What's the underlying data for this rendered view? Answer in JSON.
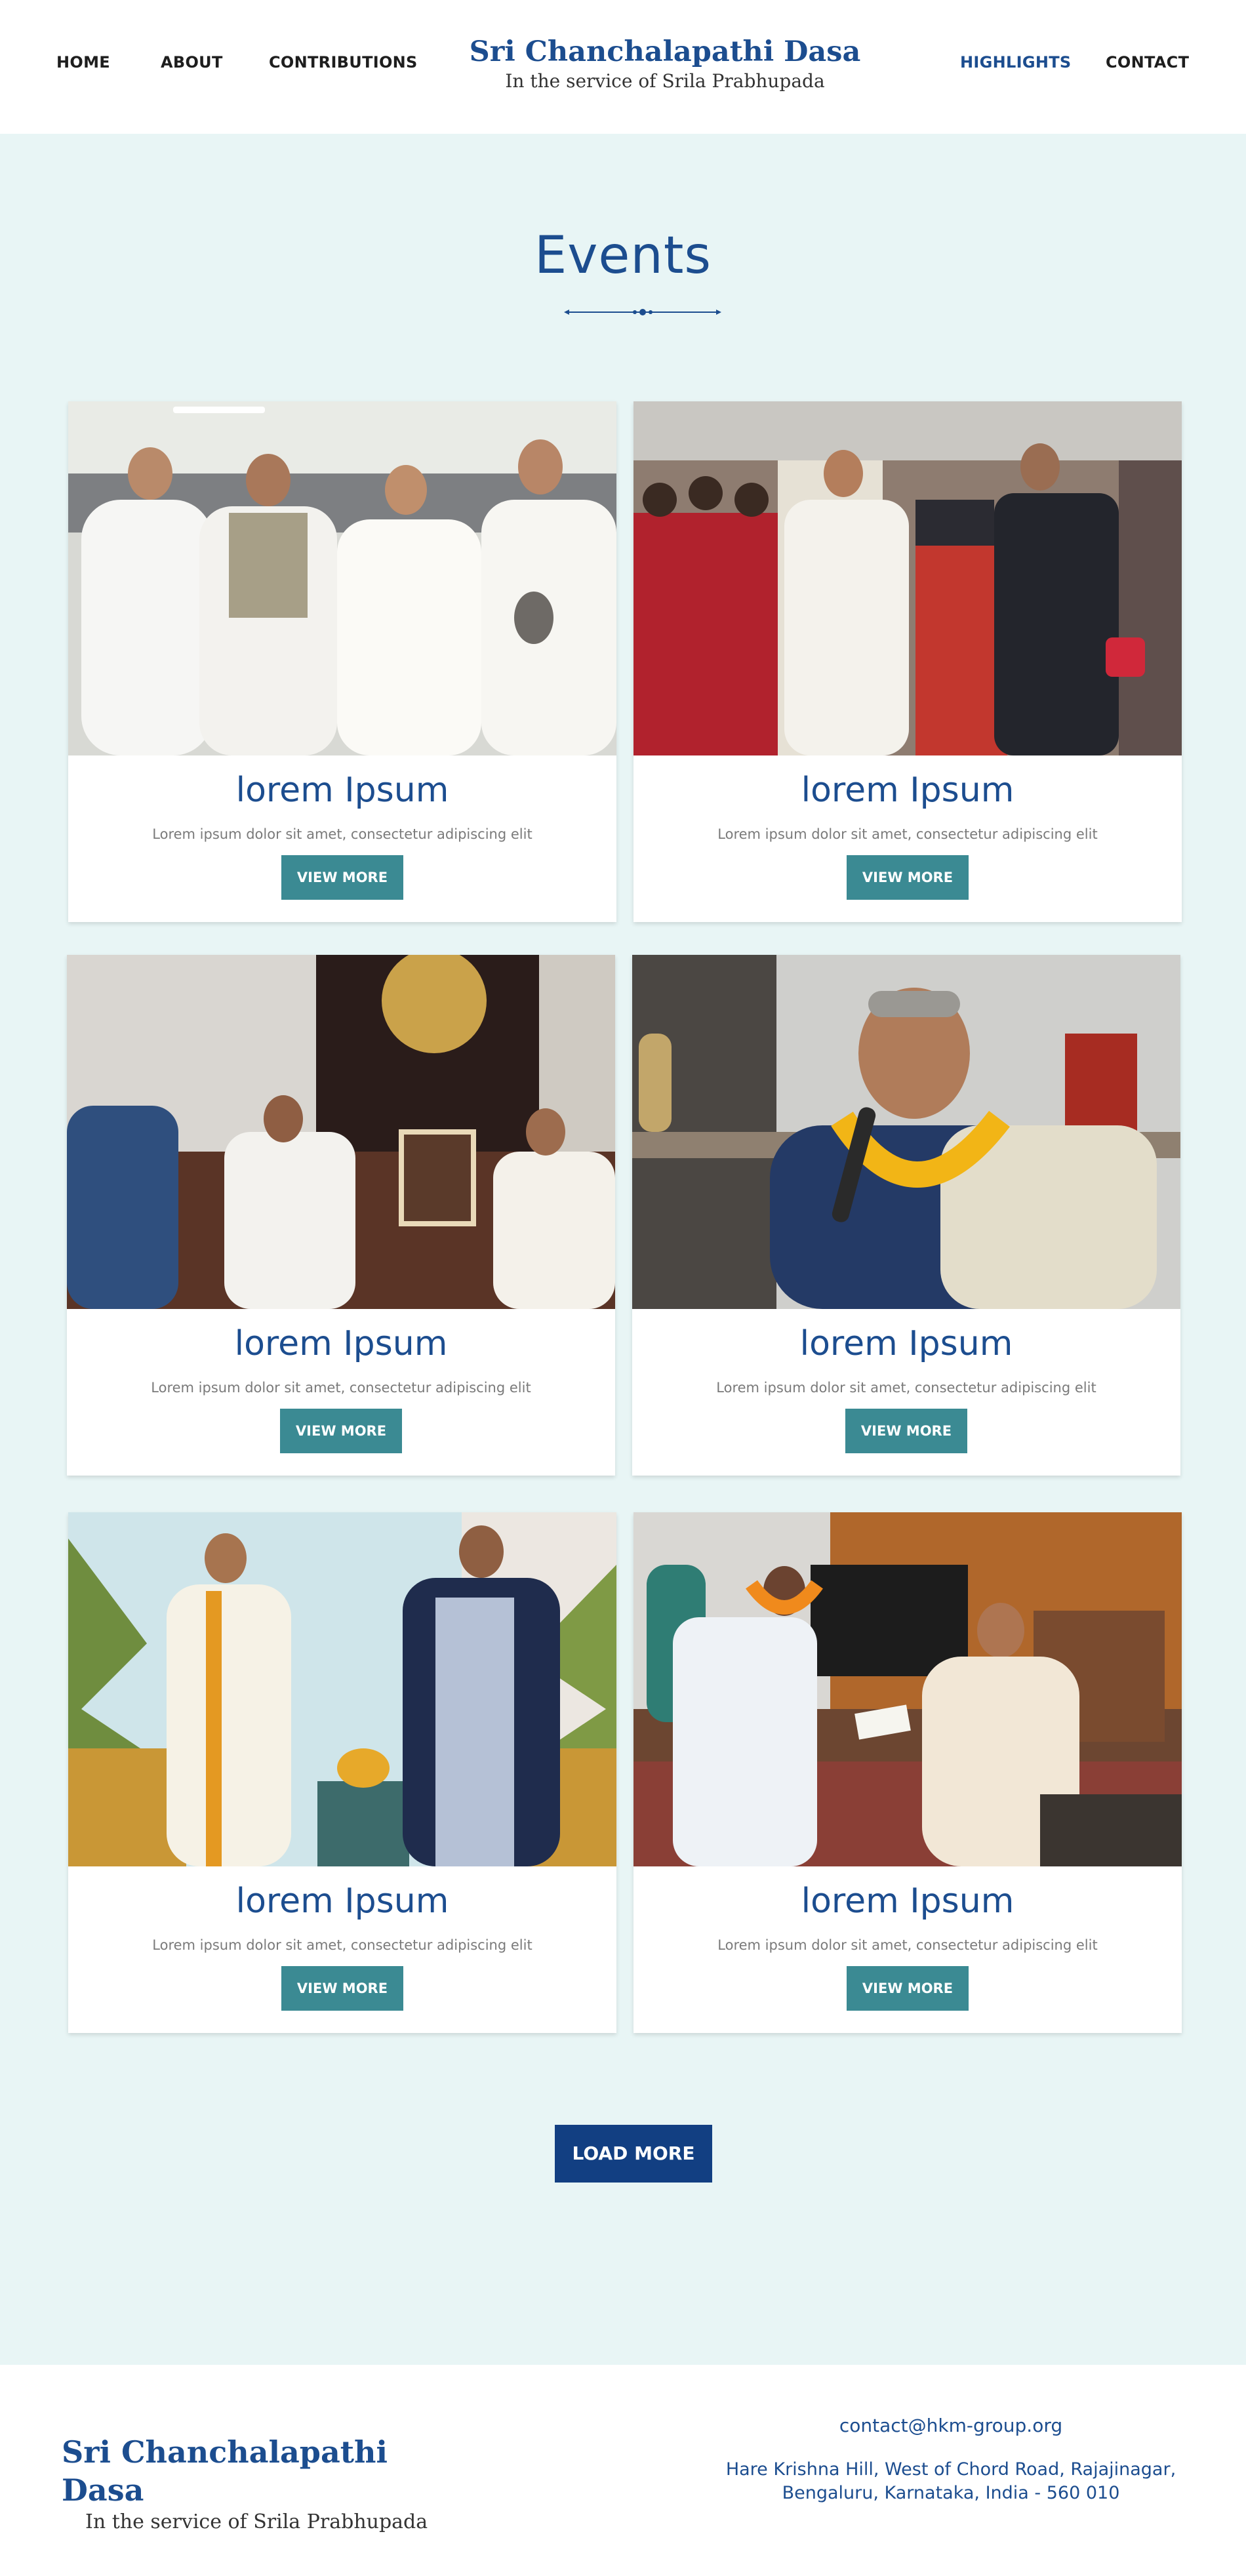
{
  "header": {
    "nav_left": [
      "HOME",
      "ABOUT",
      "CONTRIBUTIONS"
    ],
    "nav_right": [
      "HIGHLIGHTS",
      "CONTACT"
    ],
    "brand_title": "Sri Chanchalapathi Dasa",
    "brand_subtitle": "In the service of Srila Prabhupada"
  },
  "events": {
    "title": "Events",
    "cards": [
      {
        "title": "lorem Ipsum",
        "text": "Lorem ipsum dolor sit amet, consectetur adipiscing elit",
        "button": "VIEW MORE"
      },
      {
        "title": "lorem Ipsum",
        "text": "Lorem ipsum dolor sit amet, consectetur adipiscing elit",
        "button": "VIEW MORE"
      },
      {
        "title": "lorem Ipsum",
        "text": "Lorem ipsum dolor sit amet, consectetur adipiscing elit",
        "button": "VIEW MORE"
      },
      {
        "title": "lorem Ipsum",
        "text": "Lorem ipsum dolor sit amet, consectetur adipiscing elit",
        "button": "VIEW MORE"
      },
      {
        "title": "lorem Ipsum",
        "text": "Lorem ipsum dolor sit amet, consectetur adipiscing elit",
        "button": "VIEW MORE"
      },
      {
        "title": "lorem Ipsum",
        "text": "Lorem ipsum dolor sit amet, consectetur adipiscing elit",
        "button": "VIEW MORE"
      }
    ],
    "load_more": "LOAD MORE"
  },
  "footer": {
    "brand_title": "Sri Chanchalapathi Dasa",
    "brand_subtitle": "In the service of Srila Prabhupada",
    "email": "contact@hkm-group.org",
    "address_line1": "Hare Krishna Hill, West of Chord Road, Rajajinagar,",
    "address_line2": "Bengaluru, Karnataka, India - 560 010"
  },
  "colors": {
    "brand": "#1c4d8f",
    "section_bg": "#e8f5f5",
    "button": "#3b8a93",
    "load_more": "#123f82"
  }
}
